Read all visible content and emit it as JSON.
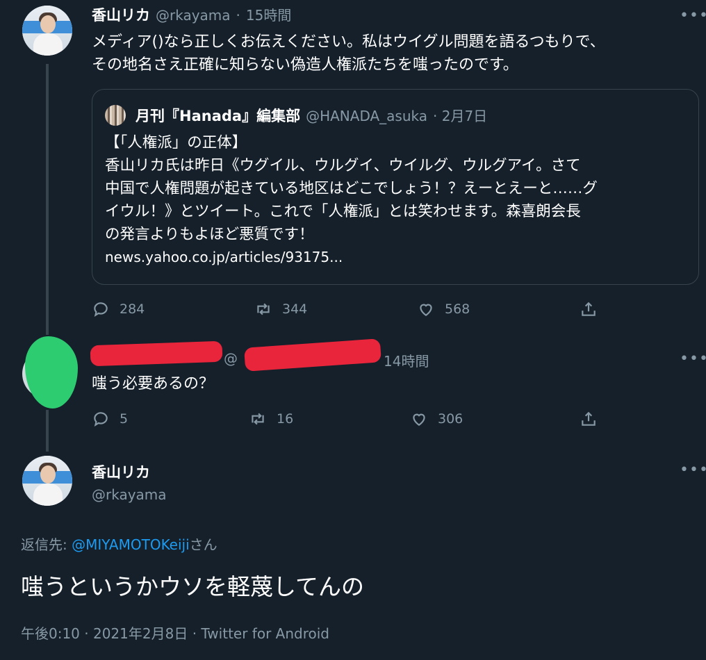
{
  "tweet1": {
    "name": "香山リカ",
    "handle": "@rkayama",
    "separator": "·",
    "time": "15時間",
    "text_line1": "メディア()なら正しくお伝えください。私はウイグル問題を語るつもりで、",
    "text_line2": "その地名さえ正確に知らない偽造人権派たちを嗤ったのです。",
    "quote": {
      "name": "月刊『Hanada』編集部",
      "handle": "@HANADA_asuka",
      "time": "· 2月7日",
      "line1": "【「人権派」の正体】",
      "line2": "香山リカ氏は昨日《ウグイル、ウルグイ、ウイルグ、ウルグアイ。さて",
      "line3": "中国で人権問題が起きている地区はどこでしょう！？えーとえーと……グ",
      "line4": "イウル！》とツイート。これで「人権派」とは笑わせます。森喜朗会長",
      "line5": "の発言よりもよほど悪質です！",
      "link": "news.yahoo.co.jp/articles/93175..."
    },
    "replies": "284",
    "retweets": "344",
    "likes": "568"
  },
  "tweet2": {
    "handle_partial": "@",
    "time": "14時間",
    "text": "嗤う必要あるの？",
    "replies": "5",
    "retweets": "16",
    "likes": "306"
  },
  "tweet3": {
    "name": "香山リカ",
    "handle": "@rkayama",
    "reply_to_prefix": "返信先: ",
    "reply_to_user": "@MIYAMOTOKeiji",
    "reply_to_suffix": "さん",
    "text": "嗤うというかウソを軽蔑してんの",
    "meta": "午後0:10 · 2021年2月8日 · Twitter for Android"
  },
  "icons": {
    "more": "more-horizontal-icon",
    "reply": "reply-bubble-icon",
    "retweet": "retweet-arrows-icon",
    "like": "heart-icon",
    "share": "share-upload-icon"
  },
  "colors": {
    "background": "#15202b",
    "text": "#ffffff",
    "muted": "#8899a6",
    "link": "#1d9bf0",
    "redaction": "#e8253b",
    "blot": "#2ecc71"
  }
}
